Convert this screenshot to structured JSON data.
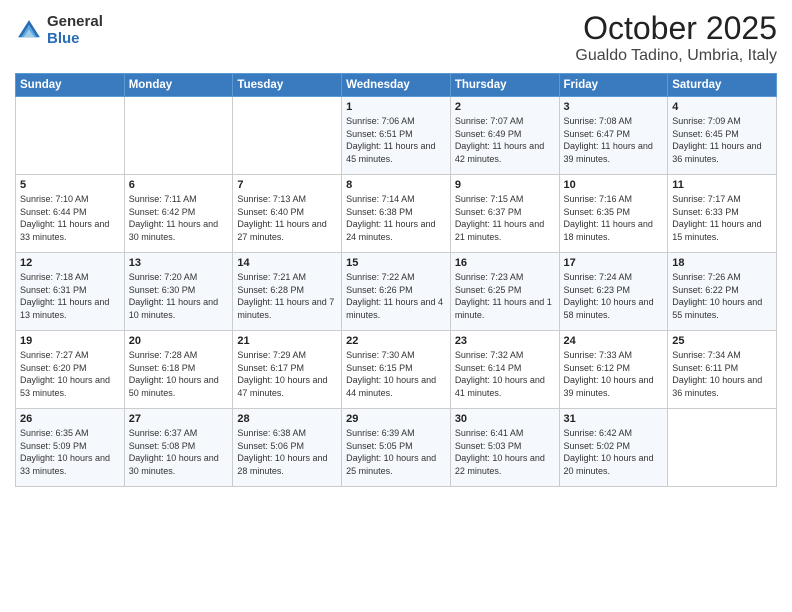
{
  "header": {
    "logo": {
      "general": "General",
      "blue": "Blue"
    },
    "month": "October 2025",
    "location": "Gualdo Tadino, Umbria, Italy"
  },
  "weekdays": [
    "Sunday",
    "Monday",
    "Tuesday",
    "Wednesday",
    "Thursday",
    "Friday",
    "Saturday"
  ],
  "weeks": [
    [
      {
        "day": "",
        "sunrise": "",
        "sunset": "",
        "daylight": ""
      },
      {
        "day": "",
        "sunrise": "",
        "sunset": "",
        "daylight": ""
      },
      {
        "day": "",
        "sunrise": "",
        "sunset": "",
        "daylight": ""
      },
      {
        "day": "1",
        "sunrise": "Sunrise: 7:06 AM",
        "sunset": "Sunset: 6:51 PM",
        "daylight": "Daylight: 11 hours and 45 minutes."
      },
      {
        "day": "2",
        "sunrise": "Sunrise: 7:07 AM",
        "sunset": "Sunset: 6:49 PM",
        "daylight": "Daylight: 11 hours and 42 minutes."
      },
      {
        "day": "3",
        "sunrise": "Sunrise: 7:08 AM",
        "sunset": "Sunset: 6:47 PM",
        "daylight": "Daylight: 11 hours and 39 minutes."
      },
      {
        "day": "4",
        "sunrise": "Sunrise: 7:09 AM",
        "sunset": "Sunset: 6:45 PM",
        "daylight": "Daylight: 11 hours and 36 minutes."
      }
    ],
    [
      {
        "day": "5",
        "sunrise": "Sunrise: 7:10 AM",
        "sunset": "Sunset: 6:44 PM",
        "daylight": "Daylight: 11 hours and 33 minutes."
      },
      {
        "day": "6",
        "sunrise": "Sunrise: 7:11 AM",
        "sunset": "Sunset: 6:42 PM",
        "daylight": "Daylight: 11 hours and 30 minutes."
      },
      {
        "day": "7",
        "sunrise": "Sunrise: 7:13 AM",
        "sunset": "Sunset: 6:40 PM",
        "daylight": "Daylight: 11 hours and 27 minutes."
      },
      {
        "day": "8",
        "sunrise": "Sunrise: 7:14 AM",
        "sunset": "Sunset: 6:38 PM",
        "daylight": "Daylight: 11 hours and 24 minutes."
      },
      {
        "day": "9",
        "sunrise": "Sunrise: 7:15 AM",
        "sunset": "Sunset: 6:37 PM",
        "daylight": "Daylight: 11 hours and 21 minutes."
      },
      {
        "day": "10",
        "sunrise": "Sunrise: 7:16 AM",
        "sunset": "Sunset: 6:35 PM",
        "daylight": "Daylight: 11 hours and 18 minutes."
      },
      {
        "day": "11",
        "sunrise": "Sunrise: 7:17 AM",
        "sunset": "Sunset: 6:33 PM",
        "daylight": "Daylight: 11 hours and 15 minutes."
      }
    ],
    [
      {
        "day": "12",
        "sunrise": "Sunrise: 7:18 AM",
        "sunset": "Sunset: 6:31 PM",
        "daylight": "Daylight: 11 hours and 13 minutes."
      },
      {
        "day": "13",
        "sunrise": "Sunrise: 7:20 AM",
        "sunset": "Sunset: 6:30 PM",
        "daylight": "Daylight: 11 hours and 10 minutes."
      },
      {
        "day": "14",
        "sunrise": "Sunrise: 7:21 AM",
        "sunset": "Sunset: 6:28 PM",
        "daylight": "Daylight: 11 hours and 7 minutes."
      },
      {
        "day": "15",
        "sunrise": "Sunrise: 7:22 AM",
        "sunset": "Sunset: 6:26 PM",
        "daylight": "Daylight: 11 hours and 4 minutes."
      },
      {
        "day": "16",
        "sunrise": "Sunrise: 7:23 AM",
        "sunset": "Sunset: 6:25 PM",
        "daylight": "Daylight: 11 hours and 1 minute."
      },
      {
        "day": "17",
        "sunrise": "Sunrise: 7:24 AM",
        "sunset": "Sunset: 6:23 PM",
        "daylight": "Daylight: 10 hours and 58 minutes."
      },
      {
        "day": "18",
        "sunrise": "Sunrise: 7:26 AM",
        "sunset": "Sunset: 6:22 PM",
        "daylight": "Daylight: 10 hours and 55 minutes."
      }
    ],
    [
      {
        "day": "19",
        "sunrise": "Sunrise: 7:27 AM",
        "sunset": "Sunset: 6:20 PM",
        "daylight": "Daylight: 10 hours and 53 minutes."
      },
      {
        "day": "20",
        "sunrise": "Sunrise: 7:28 AM",
        "sunset": "Sunset: 6:18 PM",
        "daylight": "Daylight: 10 hours and 50 minutes."
      },
      {
        "day": "21",
        "sunrise": "Sunrise: 7:29 AM",
        "sunset": "Sunset: 6:17 PM",
        "daylight": "Daylight: 10 hours and 47 minutes."
      },
      {
        "day": "22",
        "sunrise": "Sunrise: 7:30 AM",
        "sunset": "Sunset: 6:15 PM",
        "daylight": "Daylight: 10 hours and 44 minutes."
      },
      {
        "day": "23",
        "sunrise": "Sunrise: 7:32 AM",
        "sunset": "Sunset: 6:14 PM",
        "daylight": "Daylight: 10 hours and 41 minutes."
      },
      {
        "day": "24",
        "sunrise": "Sunrise: 7:33 AM",
        "sunset": "Sunset: 6:12 PM",
        "daylight": "Daylight: 10 hours and 39 minutes."
      },
      {
        "day": "25",
        "sunrise": "Sunrise: 7:34 AM",
        "sunset": "Sunset: 6:11 PM",
        "daylight": "Daylight: 10 hours and 36 minutes."
      }
    ],
    [
      {
        "day": "26",
        "sunrise": "Sunrise: 6:35 AM",
        "sunset": "Sunset: 5:09 PM",
        "daylight": "Daylight: 10 hours and 33 minutes."
      },
      {
        "day": "27",
        "sunrise": "Sunrise: 6:37 AM",
        "sunset": "Sunset: 5:08 PM",
        "daylight": "Daylight: 10 hours and 30 minutes."
      },
      {
        "day": "28",
        "sunrise": "Sunrise: 6:38 AM",
        "sunset": "Sunset: 5:06 PM",
        "daylight": "Daylight: 10 hours and 28 minutes."
      },
      {
        "day": "29",
        "sunrise": "Sunrise: 6:39 AM",
        "sunset": "Sunset: 5:05 PM",
        "daylight": "Daylight: 10 hours and 25 minutes."
      },
      {
        "day": "30",
        "sunrise": "Sunrise: 6:41 AM",
        "sunset": "Sunset: 5:03 PM",
        "daylight": "Daylight: 10 hours and 22 minutes."
      },
      {
        "day": "31",
        "sunrise": "Sunrise: 6:42 AM",
        "sunset": "Sunset: 5:02 PM",
        "daylight": "Daylight: 10 hours and 20 minutes."
      },
      {
        "day": "",
        "sunrise": "",
        "sunset": "",
        "daylight": ""
      }
    ]
  ]
}
